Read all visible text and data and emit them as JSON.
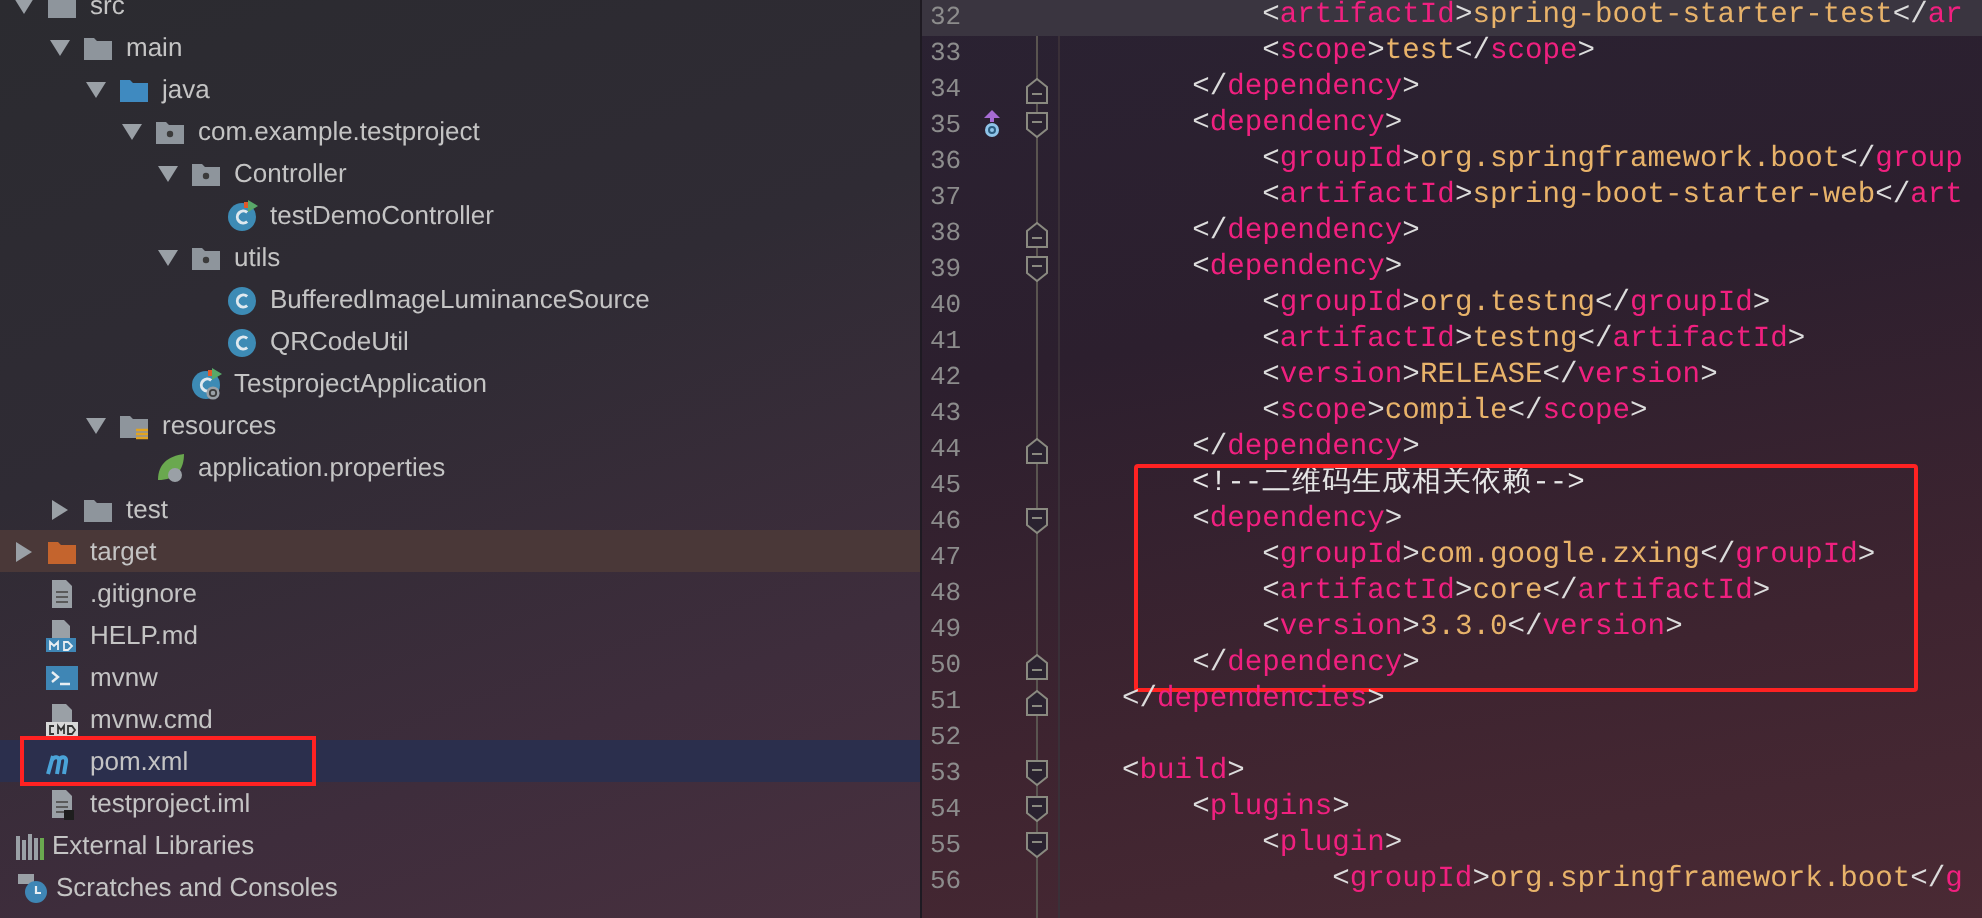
{
  "project_tree": {
    "items": [
      {
        "label": "src",
        "kind": "folder",
        "expanded": true,
        "selected": false,
        "highlighted": false,
        "boxed": false,
        "children": [
          {
            "label": "main",
            "kind": "folder",
            "expanded": true,
            "selected": false,
            "highlighted": false,
            "boxed": false,
            "children": [
              {
                "label": "java",
                "kind": "source-folder",
                "expanded": true,
                "selected": false,
                "highlighted": false,
                "boxed": false,
                "children": [
                  {
                    "label": "com.example.testproject",
                    "kind": "package",
                    "expanded": true,
                    "selected": false,
                    "highlighted": false,
                    "boxed": false,
                    "children": [
                      {
                        "label": "Controller",
                        "kind": "package",
                        "expanded": true,
                        "selected": false,
                        "highlighted": false,
                        "boxed": false,
                        "children": [
                          {
                            "label": "testDemoController",
                            "kind": "class-run",
                            "selected": false,
                            "highlighted": false,
                            "boxed": false
                          }
                        ]
                      },
                      {
                        "label": "utils",
                        "kind": "package",
                        "expanded": true,
                        "selected": false,
                        "highlighted": false,
                        "boxed": false,
                        "children": [
                          {
                            "label": "BufferedImageLuminanceSource",
                            "kind": "class",
                            "selected": false,
                            "highlighted": false,
                            "boxed": false
                          },
                          {
                            "label": "QRCodeUtil",
                            "kind": "class",
                            "selected": false,
                            "highlighted": false,
                            "boxed": false
                          }
                        ]
                      },
                      {
                        "label": "TestprojectApplication",
                        "kind": "boot-app",
                        "selected": false,
                        "highlighted": false,
                        "boxed": false
                      }
                    ]
                  }
                ]
              },
              {
                "label": "resources",
                "kind": "resources-folder",
                "expanded": true,
                "selected": false,
                "highlighted": false,
                "boxed": false,
                "children": [
                  {
                    "label": "application.properties",
                    "kind": "properties",
                    "selected": false,
                    "highlighted": false,
                    "boxed": false
                  }
                ]
              }
            ]
          },
          {
            "label": "test",
            "kind": "folder",
            "expanded": false,
            "selected": false,
            "highlighted": false,
            "boxed": false
          }
        ]
      },
      {
        "label": "target",
        "kind": "excluded-folder",
        "expanded": false,
        "selected": false,
        "highlighted": true,
        "boxed": false
      },
      {
        "label": ".gitignore",
        "kind": "text-file",
        "selected": false,
        "highlighted": false,
        "boxed": false
      },
      {
        "label": "HELP.md",
        "kind": "markdown",
        "selected": false,
        "highlighted": false,
        "boxed": false
      },
      {
        "label": "mvnw",
        "kind": "shell",
        "selected": false,
        "highlighted": false,
        "boxed": false
      },
      {
        "label": "mvnw.cmd",
        "kind": "cmd",
        "selected": false,
        "highlighted": false,
        "boxed": false
      },
      {
        "label": "pom.xml",
        "kind": "maven",
        "selected": true,
        "highlighted": false,
        "boxed": true
      },
      {
        "label": "testproject.iml",
        "kind": "module-file",
        "selected": false,
        "highlighted": false,
        "boxed": false
      }
    ],
    "roots": [
      {
        "label": "External Libraries",
        "kind": "libraries",
        "selected": false
      },
      {
        "label": "Scratches and Consoles",
        "kind": "scratches",
        "selected": false
      }
    ]
  },
  "editor": {
    "sections": [
      {
        "boxed": false,
        "lines": [
          {
            "number": "32",
            "code": "            <artifactId>spring-boot-starter-test</ar",
            "current": true
          },
          {
            "number": "33",
            "code": "            <scope>test</scope>",
            "current": false
          },
          {
            "number": "34",
            "code": "        </dependency>",
            "current": false
          },
          {
            "number": "35",
            "code": "        <dependency>",
            "current": false,
            "markers": [
              {
                "kind": "override"
              }
            ]
          },
          {
            "number": "36",
            "code": "            <groupId>org.springframework.boot</group",
            "current": false
          },
          {
            "number": "37",
            "code": "            <artifactId>spring-boot-starter-web</art",
            "current": false
          },
          {
            "number": "38",
            "code": "        </dependency>",
            "current": false
          },
          {
            "number": "39",
            "code": "        <dependency>",
            "current": false
          },
          {
            "number": "40",
            "code": "            <groupId>org.testng</groupId>",
            "current": false
          },
          {
            "number": "41",
            "code": "            <artifactId>testng</artifactId>",
            "current": false
          },
          {
            "number": "42",
            "code": "            <version>RELEASE</version>",
            "current": false
          },
          {
            "number": "43",
            "code": "            <scope>compile</scope>",
            "current": false
          },
          {
            "number": "44",
            "code": "        </dependency>",
            "current": false
          }
        ]
      },
      {
        "boxed": true,
        "lines": [
          {
            "number": "45",
            "code": "        <!--二维码生成相关依赖-->",
            "current": false,
            "kind": "comment"
          },
          {
            "number": "46",
            "code": "        <dependency>",
            "current": false
          },
          {
            "number": "47",
            "code": "            <groupId>com.google.zxing</groupId>",
            "current": false
          },
          {
            "number": "48",
            "code": "            <artifactId>core</artifactId>",
            "current": false
          },
          {
            "number": "49",
            "code": "            <version>3.3.0</version>",
            "current": false
          },
          {
            "number": "50",
            "code": "        </dependency>",
            "current": false
          }
        ]
      },
      {
        "boxed": false,
        "lines": [
          {
            "number": "51",
            "code": "    </dependencies>",
            "current": false
          },
          {
            "number": "52",
            "current": false
          },
          {
            "number": "53",
            "code": "    <build>",
            "current": false
          },
          {
            "number": "54",
            "code": "        <plugins>",
            "current": false
          },
          {
            "number": "55",
            "code": "            <plugin>",
            "current": false
          },
          {
            "number": "56",
            "code": "                <groupId>org.springframework.boot</g",
            "current": false
          }
        ]
      }
    ]
  }
}
